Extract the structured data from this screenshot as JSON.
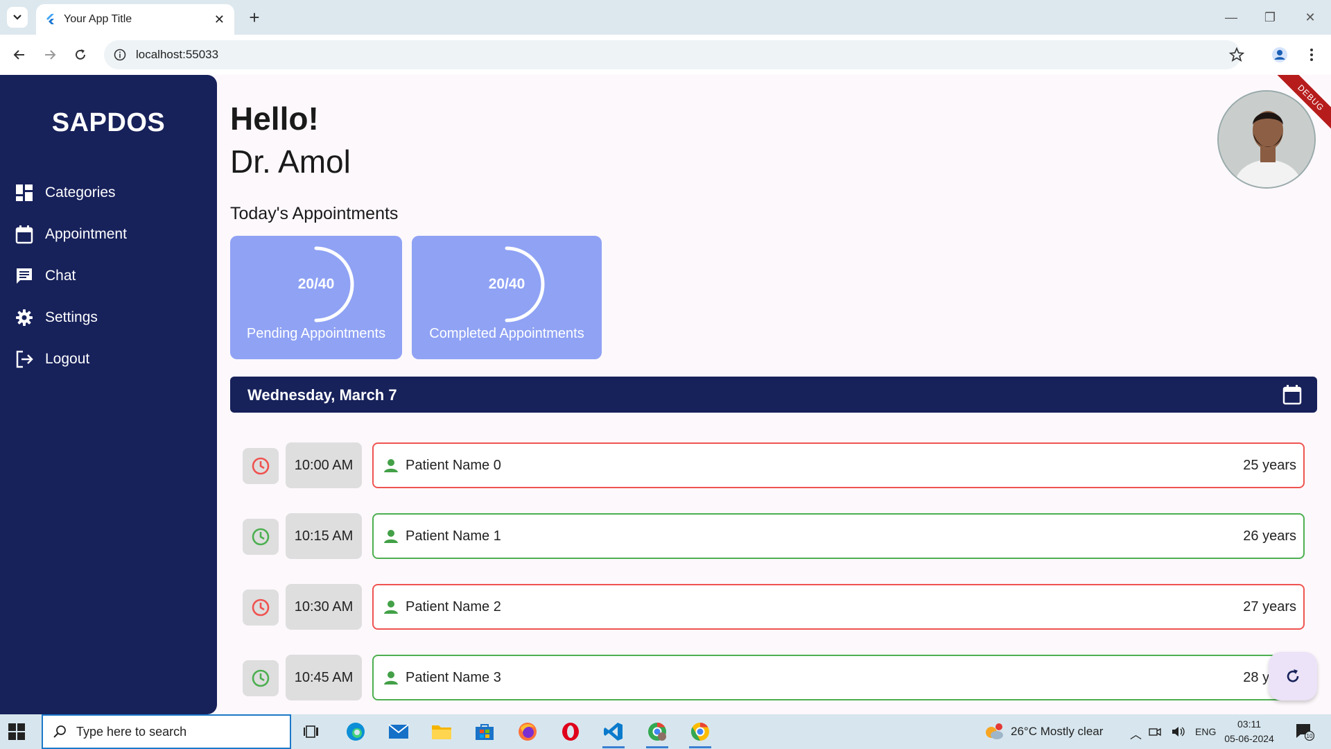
{
  "browser": {
    "tab_title": "Your App Title",
    "url": "localhost:55033"
  },
  "app": {
    "brand": "SAPDOS",
    "debug_label": "DEBUG",
    "nav": [
      {
        "label": "Categories",
        "icon": "dashboard-icon"
      },
      {
        "label": "Appointment",
        "icon": "calendar-icon"
      },
      {
        "label": "Chat",
        "icon": "chat-icon"
      },
      {
        "label": "Settings",
        "icon": "gear-icon"
      },
      {
        "label": "Logout",
        "icon": "logout-icon"
      }
    ],
    "greeting": "Hello!",
    "doctor_name": "Dr. Amol",
    "section_title": "Today's Appointments",
    "stats": [
      {
        "value": "20/40",
        "label": "Pending Appointments",
        "progress": 0.5
      },
      {
        "value": "20/40",
        "label": "Completed Appointments",
        "progress": 0.5
      }
    ],
    "date": "Wednesday, March 7",
    "appointments": [
      {
        "time": "10:00 AM",
        "patient": "Patient Name 0",
        "age": "25 years",
        "status": "red"
      },
      {
        "time": "10:15 AM",
        "patient": "Patient Name 1",
        "age": "26 years",
        "status": "green"
      },
      {
        "time": "10:30 AM",
        "patient": "Patient Name 2",
        "age": "27 years",
        "status": "red"
      },
      {
        "time": "10:45 AM",
        "patient": "Patient Name 3",
        "age": "28 years",
        "status": "green"
      }
    ],
    "colors": {
      "sidebar": "#17215a",
      "card": "#8fa2f4",
      "red": "#ef5350",
      "green": "#4caf50"
    }
  },
  "taskbar": {
    "search_placeholder": "Type here to search",
    "weather": "26°C  Mostly clear",
    "weather_badge": "1",
    "lang": "ENG",
    "time": "03:11",
    "date": "05-06-2024",
    "notification_count": "10"
  }
}
